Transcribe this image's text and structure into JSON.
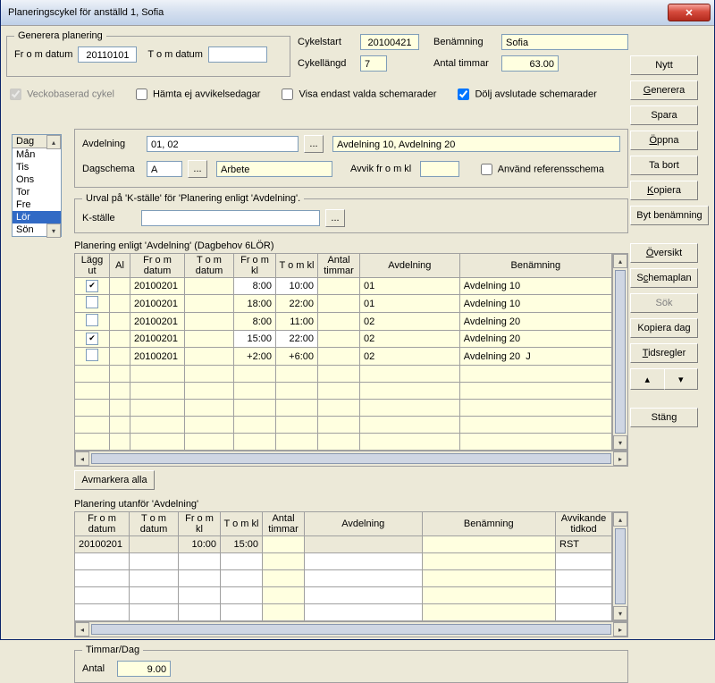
{
  "window": {
    "title": "Planeringscykel för anställd 1, Sofia"
  },
  "generera": {
    "legend": "Generera planering",
    "from_lbl": "Fr o m datum",
    "from_val": "20110101",
    "to_lbl": "T o m datum",
    "to_val": ""
  },
  "cykel": {
    "start_lbl": "Cykelstart",
    "start_val": "20100421",
    "benamning_lbl": "Benämning",
    "benamning_val": "Sofia",
    "langd_lbl": "Cykellängd",
    "langd_val": "7",
    "timmar_lbl": "Antal timmar",
    "timmar_val": "63.00"
  },
  "checks": {
    "veckobaserad": "Veckobaserad cykel",
    "hamta_ej": "Hämta ej avvikelsedagar",
    "visa_valda": "Visa endast valda schemarader",
    "dolj_avslutade": "Dölj avslutade schemarader"
  },
  "days": {
    "header": "Dag",
    "items": [
      "Mån",
      "Tis",
      "Ons",
      "Tor",
      "Fre",
      "Lör",
      "Sön"
    ],
    "selected": "Lör"
  },
  "avdel": {
    "avdelning_lbl": "Avdelning",
    "avdelning_val": "01, 02",
    "avdelning_desc": "Avdelning 10, Avdelning 20",
    "dagschema_lbl": "Dagschema",
    "dagschema_val": "A",
    "dagschema_desc": "Arbete",
    "avvik_lbl": "Avvik fr o m kl",
    "avvik_val": "",
    "anvand_ref": "Använd referensschema"
  },
  "urval": {
    "legend": "Urval på 'K-ställe' för 'Planering enligt 'Avdelning'.",
    "kstalle_lbl": "K-ställe",
    "kstalle_val": ""
  },
  "planering1": {
    "title": "Planering enligt 'Avdelning'  (Dagbehov 6LÖR)",
    "headers": {
      "laggut": "Lägg ut",
      "al": "Al",
      "from_datum": "Fr o m datum",
      "tom_datum": "T o m datum",
      "from_kl": "Fr o m kl",
      "tom_kl": "T o m kl",
      "antal_timmar": "Antal timmar",
      "avdelning": "Avdelning",
      "benamning": "Benämning"
    },
    "rows": [
      {
        "checked": true,
        "from_datum": "20100201",
        "tom_datum": "",
        "from_kl": "8:00",
        "tom_kl": "10:00",
        "antal": "",
        "avdel": "01",
        "benamn": "Avdelning 10",
        "j": ""
      },
      {
        "checked": false,
        "from_datum": "20100201",
        "tom_datum": "",
        "from_kl": "18:00",
        "tom_kl": "22:00",
        "antal": "",
        "avdel": "01",
        "benamn": "Avdelning 10",
        "j": ""
      },
      {
        "checked": false,
        "from_datum": "20100201",
        "tom_datum": "",
        "from_kl": "8:00",
        "tom_kl": "11:00",
        "antal": "",
        "avdel": "02",
        "benamn": "Avdelning 20",
        "j": ""
      },
      {
        "checked": true,
        "from_datum": "20100201",
        "tom_datum": "",
        "from_kl": "15:00",
        "tom_kl": "22:00",
        "antal": "",
        "avdel": "02",
        "benamn": "Avdelning 20",
        "j": ""
      },
      {
        "checked": false,
        "from_datum": "20100201",
        "tom_datum": "",
        "from_kl": "+2:00",
        "tom_kl": "+6:00",
        "antal": "",
        "avdel": "02",
        "benamn": "Avdelning 20",
        "j": "J"
      }
    ],
    "avmarkera": "Avmarkera alla"
  },
  "planering2": {
    "title": "Planering utanför 'Avdelning'",
    "headers": {
      "from_datum": "Fr o m datum",
      "tom_datum": "T o m datum",
      "from_kl": "Fr o m kl",
      "tom_kl": "T o m kl",
      "antal_timmar": "Antal timmar",
      "avdelning": "Avdelning",
      "benamning": "Benämning",
      "avvik_tidkod": "Avvikande tidkod"
    },
    "rows": [
      {
        "from_datum": "20100201",
        "tom_datum": "",
        "from_kl": "10:00",
        "tom_kl": "15:00",
        "antal": "",
        "avdel": "",
        "benamn": "",
        "tidkod": "RST"
      }
    ]
  },
  "timmar_dag": {
    "legend": "Timmar/Dag",
    "antal_lbl": "Antal",
    "antal_val": "9.00"
  },
  "buttons": {
    "nytt": "Nytt",
    "generera": "Generera",
    "spara": "Spara",
    "oppna": "Öppna",
    "tabort": "Ta bort",
    "kopiera": "Kopiera",
    "byt_benamning": "Byt benämning",
    "oversikt": "Översikt",
    "schemaplan": "Schemaplan",
    "sok": "Sök",
    "kopiera_dag": "Kopiera dag",
    "tidsregler": "Tidsregler",
    "stang": "Stäng"
  }
}
